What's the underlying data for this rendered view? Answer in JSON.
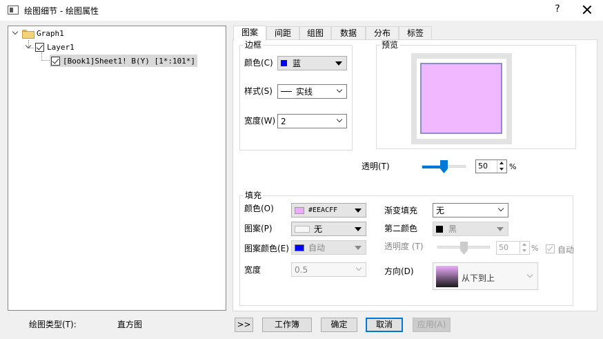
{
  "window": {
    "title": "绘图细节 - 绘图属性",
    "help": "?"
  },
  "tree": {
    "root": "Graph1",
    "layer": "Layer1",
    "plot": "[Book1]Sheet1! B(Y) [1*:101*]"
  },
  "tabs": [
    "图案",
    "间距",
    "组图",
    "数据",
    "分布",
    "标签"
  ],
  "border": {
    "legend": "边框",
    "color_label": "颜色(C)",
    "color_value": "蓝",
    "color_swatch": "#0000ff",
    "style_label": "样式(S)",
    "style_value": "实线",
    "width_label": "宽度(W)",
    "width_value": "2"
  },
  "preview": {
    "legend": "预览",
    "fill_color": "#eeacff",
    "border_color": "#7f73d6"
  },
  "transparency": {
    "label": "透明(T)",
    "value": "50",
    "unit": "%",
    "level": 0.5
  },
  "fill": {
    "legend": "填充",
    "color_label": "颜色(O)",
    "color_value": "#EEACFF",
    "color_swatch": "#eeacff",
    "pattern_label": "图案(P)",
    "pattern_value": "无",
    "pattern_color_label": "图案颜色(E)",
    "pattern_color_value": "自动",
    "pattern_color_swatch": "#0000ff",
    "width_label": "宽度",
    "width_value": "0.5",
    "gradient_label": "渐变填充",
    "gradient_value": "无",
    "second_color_label": "第二颜色",
    "second_color_value": "黑",
    "second_color_swatch": "#000000",
    "opacity_label": "透明度 (T)",
    "opacity_value": "50",
    "opacity_unit": "%",
    "opacity_level": 0.5,
    "auto_label": "自动",
    "direction_label": "方向(D)",
    "direction_value": "从下到上"
  },
  "footer": {
    "plot_type_label": "绘图类型(T):",
    "plot_type_value": "直方图",
    "expand": ">>",
    "workbook": "工作簿",
    "ok": "确定",
    "cancel": "取消",
    "apply": "应用(A)"
  }
}
